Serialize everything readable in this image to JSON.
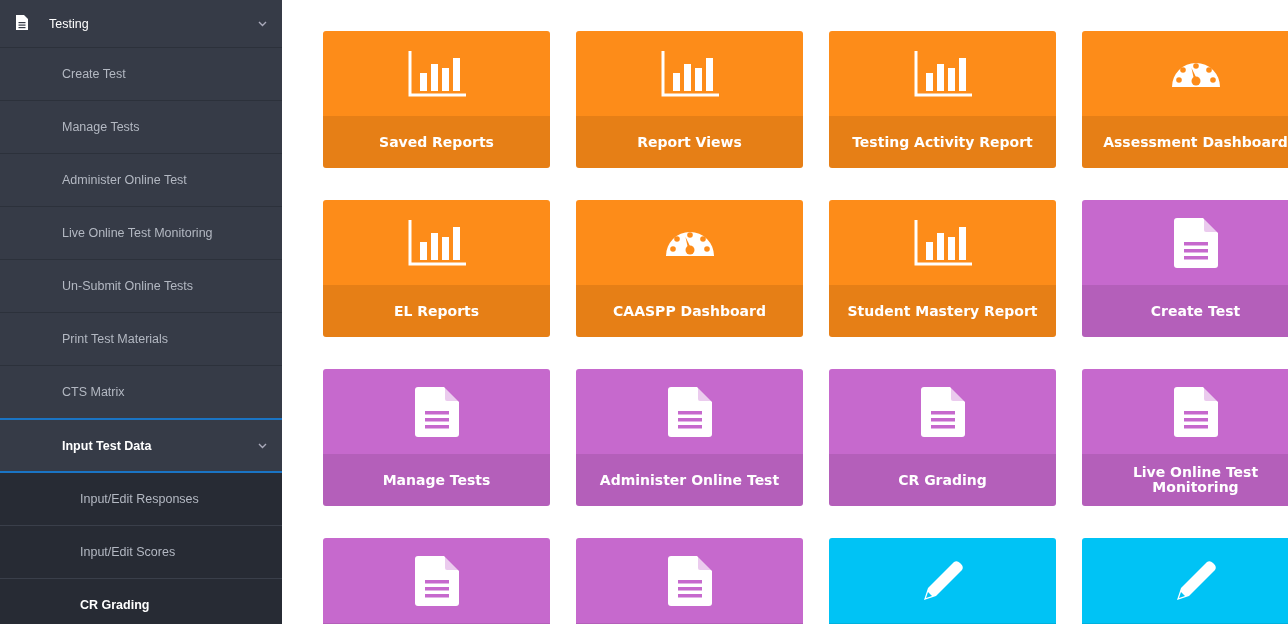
{
  "sidebar": {
    "items": [
      {
        "label": "Testing",
        "kind": "section",
        "expanded": true,
        "selected": false,
        "children": [
          {
            "label": "Create Test",
            "selected": false
          },
          {
            "label": "Manage Tests",
            "selected": false
          },
          {
            "label": "Administer Online Test",
            "selected": false
          },
          {
            "label": "Live Online Test Monitoring",
            "selected": false
          },
          {
            "label": "Un-Submit Online Tests",
            "selected": false
          },
          {
            "label": "Print Test Materials",
            "selected": false
          },
          {
            "label": "CTS Matrix",
            "selected": false
          },
          {
            "label": "Input Test Data",
            "selected": false,
            "expanded": true,
            "children": [
              {
                "label": "Input/Edit Responses",
                "selected": false
              },
              {
                "label": "Input/Edit Scores",
                "selected": false
              },
              {
                "label": "CR Grading",
                "selected": true
              }
            ]
          }
        ]
      }
    ]
  },
  "tiles": [
    {
      "label": "Saved Reports",
      "kind": "chart",
      "color": "#fd8c19"
    },
    {
      "label": "Report Views",
      "kind": "chart",
      "color": "#fd8c19"
    },
    {
      "label": "Testing Activity Report",
      "kind": "chart",
      "color": "#fd8c19"
    },
    {
      "label": "Assessment Dashboard",
      "kind": "gauge",
      "color": "#fd8c19"
    },
    {
      "label": "EL Reports",
      "kind": "chart",
      "color": "#fd8c19"
    },
    {
      "label": "CAASPP Dashboard",
      "kind": "gauge",
      "color": "#fd8c19"
    },
    {
      "label": "Student Mastery Report",
      "kind": "chart",
      "color": "#fd8c19"
    },
    {
      "label": "Create Test",
      "kind": "document",
      "color": "#c669cd"
    },
    {
      "label": "Manage Tests",
      "kind": "document",
      "color": "#c669cd"
    },
    {
      "label": "Administer Online Test",
      "kind": "document",
      "color": "#c669cd"
    },
    {
      "label": "CR Grading",
      "kind": "document",
      "color": "#c669cd"
    },
    {
      "label": "Live Online Test Monitoring",
      "kind": "document",
      "color": "#c669cd"
    },
    {
      "kind": "document",
      "color": "#c669cd"
    },
    {
      "kind": "document",
      "color": "#c669cd"
    },
    {
      "kind": "pencil",
      "color": "#00c3f5"
    },
    {
      "kind": "pencil",
      "color": "#00c3f5"
    }
  ]
}
